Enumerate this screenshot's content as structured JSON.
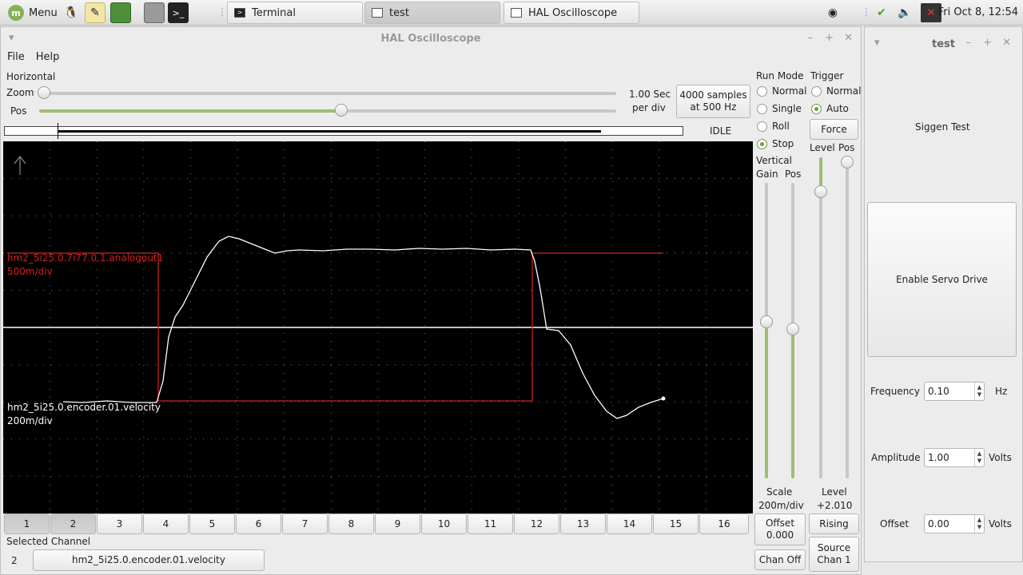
{
  "panel": {
    "menu_label": "Menu",
    "tasks": [
      {
        "label": "Terminal"
      },
      {
        "label": "test"
      },
      {
        "label": "HAL Oscilloscope"
      }
    ],
    "clock": "Fri Oct  8, 12:54"
  },
  "scope": {
    "window_title": "HAL Oscilloscope",
    "menu": {
      "file": "File",
      "help": "Help"
    },
    "horizontal": {
      "label": "Horizontal",
      "zoom_label": "Zoom",
      "pos_label": "Pos",
      "zoom_level": 0.0,
      "pos_level": 0.52
    },
    "timebase": {
      "line1": "1.00 Sec",
      "line2": "per div"
    },
    "samples_button": {
      "line1": "4000 samples",
      "line2": "at 500 Hz"
    },
    "status": "IDLE",
    "run_mode": {
      "label": "Run Mode",
      "options": [
        "Normal",
        "Single",
        "Roll",
        "Stop"
      ],
      "selected": "Stop"
    },
    "trigger": {
      "label": "Trigger",
      "options": [
        "Normal",
        "Auto"
      ],
      "selected": "Auto",
      "force_label": "Force",
      "level_label": "Level",
      "pos_label": "Pos"
    },
    "vertical": {
      "label": "Vertical",
      "gain_label": "Gain",
      "pos_label": "Pos"
    },
    "channels": {
      "red": {
        "name": "hm2_5i25.0.7i77.0.1.analogout1",
        "scale": "500m/div",
        "color": "#d02020"
      },
      "white": {
        "name": "hm2_5i25.0.encoder.01.velocity",
        "scale": "200m/div",
        "color": "#ffffff"
      }
    },
    "channel_buttons": [
      "1",
      "2",
      "3",
      "4",
      "5",
      "6",
      "7",
      "8",
      "9",
      "10",
      "11",
      "12",
      "13",
      "14",
      "15",
      "16"
    ],
    "pressed_channels": [
      "1",
      "2"
    ],
    "scale": {
      "label": "Scale",
      "value": "200m/div"
    },
    "level": {
      "label": "Level",
      "value": "+2.010"
    },
    "offset_button": {
      "line1": "Offset",
      "line2": "0.000"
    },
    "rising_button": "Rising",
    "chan_off_button": "Chan Off",
    "source_button": {
      "line1": "Source",
      "line2": "Chan  1"
    },
    "selected_channel": {
      "label": "Selected Channel",
      "number": "2",
      "name": "hm2_5i25.0.encoder.01.velocity"
    }
  },
  "test": {
    "window_title": "test",
    "heading": "Siggen Test",
    "enable_button": "Enable Servo Drive",
    "frequency": {
      "label": "Frequency",
      "value": "0.10",
      "unit": "Hz"
    },
    "amplitude": {
      "label": "Amplitude",
      "value": "1.00",
      "unit": "Volts"
    },
    "offset": {
      "label": "Offset",
      "value": "0.00",
      "unit": "Volts"
    }
  }
}
